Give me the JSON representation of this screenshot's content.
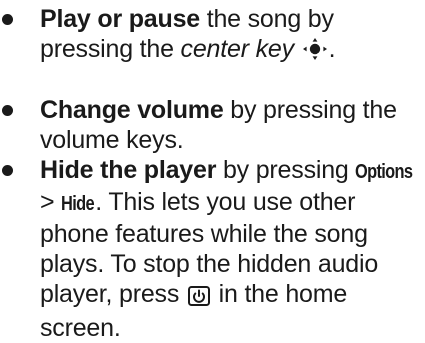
{
  "bullets": [
    {
      "bold": "Play or pause",
      "text_a": " the song by pressing the ",
      "italic": "center key",
      "icon": "nav-center-key-icon",
      "text_b": "."
    },
    {
      "bold": "Change volume",
      "text_a": " by pressing the volume keys."
    },
    {
      "bold": "Hide the player",
      "text_a": " by pressing ",
      "key_options": "Options",
      "sep": " > ",
      "key_hide": "Hide",
      "text_b": ". This lets you use other phone features while the song plays. To stop the hidden audio player, press ",
      "icon": "power-end-key-icon",
      "text_c": " in the home screen."
    }
  ]
}
